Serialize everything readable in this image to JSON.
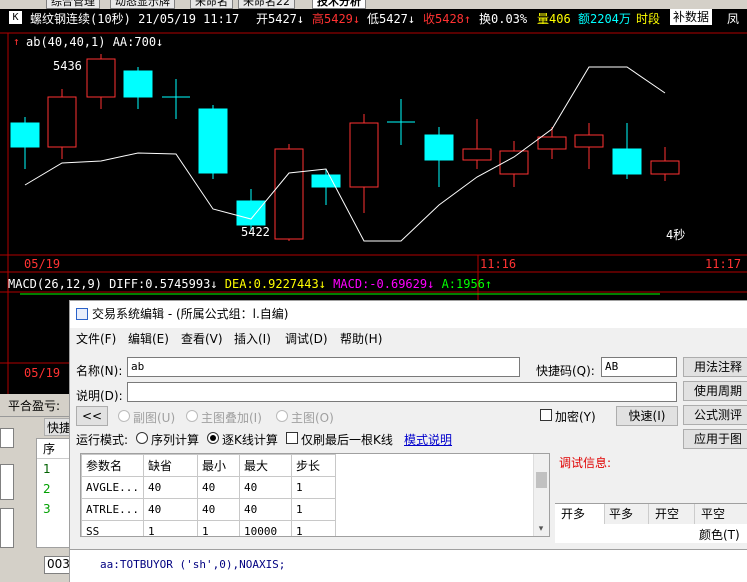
{
  "top_tabs": [
    "综合管理",
    "动态显示牌",
    "未命名",
    "未命名22",
    "技术分析"
  ],
  "chart_header": {
    "k_badge": "K",
    "title": "螺纹钢连续(10秒) 21/05/19 11:17",
    "open_label": "开5427",
    "open_arrow": "↓",
    "high_label": "高5429",
    "high_arrow": "↓",
    "low_label": "低5427",
    "low_arrow": "↓",
    "close_label": "收5428",
    "close_arrow": "↑",
    "turnover": "换0.03%",
    "volume": "量406",
    "amount": "额2204万",
    "period": "时段",
    "right_tag": "补数据",
    "right_tail": "凤"
  },
  "indicator_line": {
    "up_arrow": "↑",
    "text": "ab(40,40,1) AA:700",
    "arrow": "↓"
  },
  "chart_labels": {
    "high_price": "5436",
    "low_price": "5422",
    "interval": "4秒",
    "time_start": "05/19",
    "time_mid": "11:16",
    "time_end": "11:17",
    "time_lower": "05/19"
  },
  "macd_line": {
    "params": "MACD(26,12,9)",
    "diff": "DIFF:0.5745993",
    "diff_arrow": "↓",
    "dea": "DEA:0.9227443",
    "dea_arrow": "↓",
    "macd": "MACD:-0.69629",
    "macd_arrow": "↓",
    "a": "A:1956",
    "a_arrow": "↑"
  },
  "colors": {
    "up": "#ff3232",
    "down": "#00ffff",
    "doji": "#00ffff",
    "line": "#ffffff",
    "dea": "#ffff00",
    "macd": "#ff00ff",
    "a": "#00ff00",
    "grid": "#b00000"
  },
  "bottom_left": {
    "panel_label": "平合盈亏:",
    "tab_label": "快捷",
    "col_header": "序",
    "rows": [
      "1",
      "2",
      "3"
    ],
    "code": "003"
  },
  "dialog": {
    "title": "交易系统编辑 - (所属公式组：l.自编)",
    "menu": [
      "文件(F)",
      "编辑(E)",
      "查看(V)",
      "插入(I)",
      "调试(D)",
      "帮助(H)"
    ],
    "name_label": "名称(N):",
    "name_value": "ab",
    "shortcut_label": "快捷码(Q):",
    "shortcut_value": "AB",
    "desc_label": "说明(D):",
    "desc_value": "",
    "collapse_button": "<<",
    "radio_sub": "副图(U)",
    "radio_main_overlay": "主图叠加(I)",
    "radio_main": "主图(O)",
    "encrypt_label": "加密(Y)",
    "quick_button": "快速(I)",
    "run_mode_label": "运行模式:",
    "run_sequence": "序列计算",
    "run_bar": "逐K线计算",
    "refresh_last": "仅刷最后一根K线",
    "mode_help_link": "模式说明",
    "params_headers": [
      "参数名",
      "缺省",
      "最小",
      "最大",
      "步长"
    ],
    "params_rows": [
      [
        "AVGLE...",
        "40",
        "40",
        "40",
        "1"
      ],
      [
        "ATRLE...",
        "40",
        "40",
        "40",
        "1"
      ],
      [
        "SS",
        "1",
        "1",
        "10000",
        "1"
      ]
    ],
    "debug_label": "调试信息:",
    "right_buttons": [
      "用法注释",
      "使用周期",
      "公式测评",
      "应用于图"
    ],
    "signal_tabs": [
      "开多",
      "平多",
      "开空",
      "平空"
    ],
    "color_label": "颜色(T)",
    "code_text": "aa:TOTBUYOR ('sh',0),NOAXIS;"
  }
}
